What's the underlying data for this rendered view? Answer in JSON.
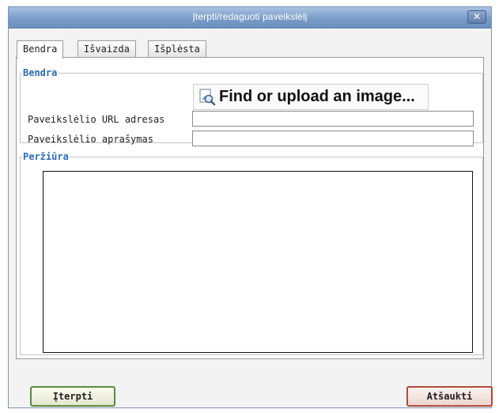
{
  "dialog": {
    "title": "Įterpti/redaguoti paveikslėlį",
    "close_symbol": "✕"
  },
  "tabs": [
    {
      "label": "Bendra",
      "active": true
    },
    {
      "label": "Išvaizda",
      "active": false
    },
    {
      "label": "Išplėsta",
      "active": false
    }
  ],
  "general": {
    "legend": "Bendra",
    "find_button": {
      "label": "Find or upload an image...",
      "icon": "image-search-icon"
    },
    "url_label": "Paveikslėlio URL adresas",
    "url_value": "",
    "desc_label": "Paveikslėlio aprašymas",
    "desc_value": ""
  },
  "preview": {
    "legend": "Peržiūra"
  },
  "buttons": {
    "insert": "Įterpti",
    "cancel": "Atšaukti"
  },
  "colors": {
    "legend": "#2b6ab7",
    "titlebar": "#7b9cc8",
    "insert_border": "#5e8a3a",
    "cancel_border": "#b34a3a"
  }
}
